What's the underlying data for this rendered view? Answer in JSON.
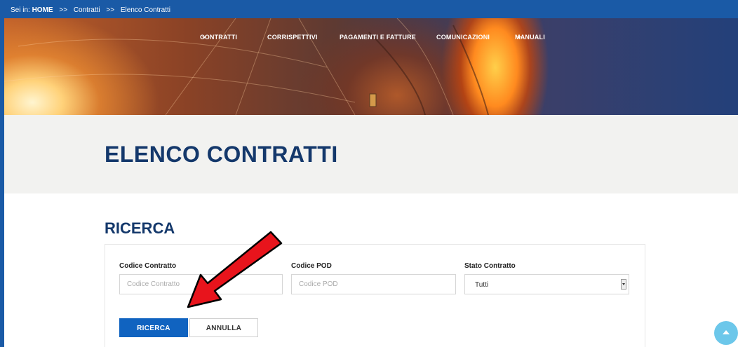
{
  "breadcrumb": {
    "prefix": "Sei in:",
    "home": "HOME",
    "separator": ">>",
    "items": [
      "Contratti",
      "Elenco Contratti"
    ]
  },
  "nav": {
    "items": [
      {
        "label": "CONTRATTI",
        "dropdown": true
      },
      {
        "label": "CORRISPETTIVI",
        "dropdown": false
      },
      {
        "label": "PAGAMENTI E FATTURE",
        "dropdown": false
      },
      {
        "label": "COMUNICAZIONI",
        "dropdown": false
      },
      {
        "label": "MANUALI",
        "dropdown": true
      }
    ]
  },
  "page": {
    "title": "ELENCO CONTRATTI"
  },
  "search": {
    "section_title": "RICERCA",
    "fields": {
      "codice_contratto": {
        "label": "Codice Contratto",
        "placeholder": "Codice Contratto",
        "value": ""
      },
      "codice_pod": {
        "label": "Codice POD",
        "placeholder": "Codice POD",
        "value": ""
      },
      "stato_contratto": {
        "label": "Stato Contratto",
        "selected": "Tutti"
      }
    },
    "buttons": {
      "search": "RICERCA",
      "cancel": "ANNULLA"
    }
  },
  "icons": {
    "annotation": "red-arrow-icon",
    "scroll_top": "chevron-up-icon",
    "select_arrow": "chevron-down-icon"
  },
  "colors": {
    "brand_blue": "#1a5aa6",
    "title_navy": "#14386b",
    "primary_button": "#1063c0",
    "annotation_red": "#e8141c",
    "scroll_top": "#6cc7ea"
  }
}
